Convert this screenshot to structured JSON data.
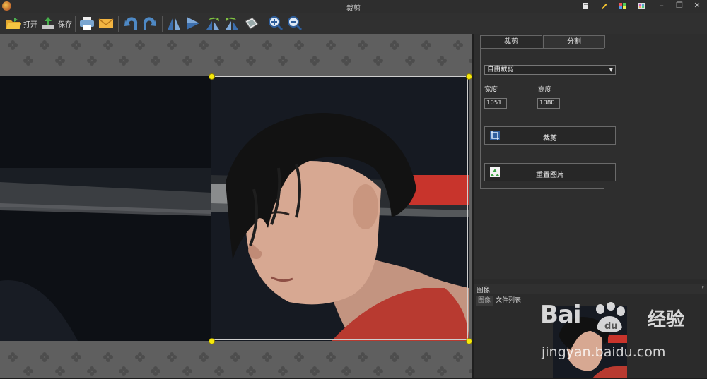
{
  "window": {
    "title": "裁剪",
    "controls": {
      "minimize": "–",
      "restore": "❐",
      "close": "✕"
    },
    "title_icons": [
      "page-icon",
      "pencil-icon",
      "palette-icon",
      "palette-grid-icon"
    ]
  },
  "toolbar": {
    "open_label": "打开",
    "save_label": "保存",
    "buttons": [
      "open-folder-icon",
      "save-icon",
      "print-icon",
      "email-icon",
      "undo-icon",
      "redo-icon",
      "flip-vertical-icon",
      "flip-horizontal-icon",
      "rotate-left-icon",
      "rotate-right-icon",
      "transform-icon",
      "zoom-in-icon",
      "zoom-out-icon"
    ]
  },
  "right_panel": {
    "tabs": [
      "裁剪",
      "分割"
    ],
    "active_tab": "裁剪",
    "crop_mode": {
      "selected": "自由裁剪"
    },
    "width_label": "宽度",
    "height_label": "高度",
    "width_value": "1051",
    "height_value": "1080",
    "crop_button_label": "裁剪",
    "reset_button_label": "重置图片"
  },
  "image_panel": {
    "title": "图像",
    "pin": "ᵖ",
    "tabs": [
      "图像",
      "文件列表"
    ]
  },
  "watermark": {
    "brand": "Bai",
    "brand_suffix": "经验",
    "url": "jingyan.baidu.com"
  },
  "colors": {
    "canvas_bg": "#5f5f5f",
    "crop_handle": "#f6e90b",
    "panel_bg": "#2e2e2e"
  }
}
